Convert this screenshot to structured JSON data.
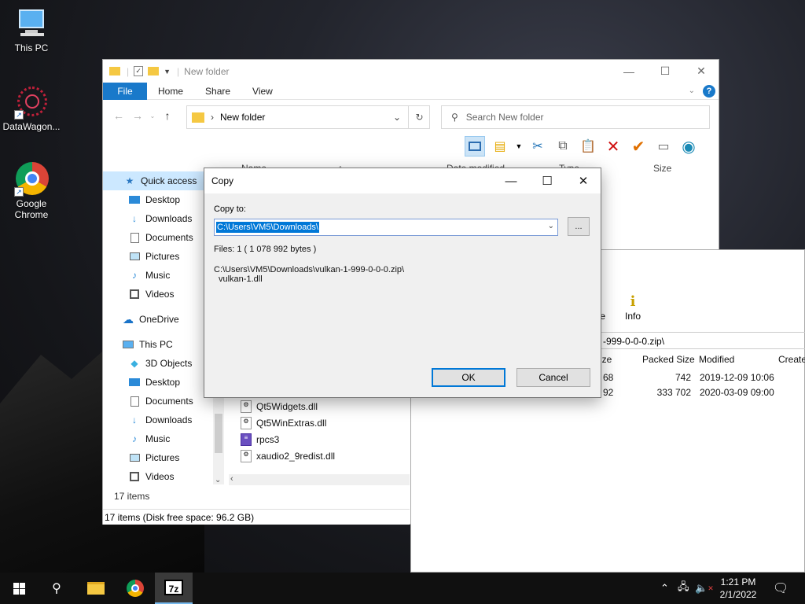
{
  "desktop": {
    "icons": [
      {
        "label": "This PC"
      },
      {
        "label": "DataWagon..."
      },
      {
        "label": "Google Chrome"
      }
    ]
  },
  "explorer": {
    "title": "New folder",
    "tabs": {
      "file": "File",
      "home": "Home",
      "share": "Share",
      "view": "View"
    },
    "address": "New folder",
    "search_placeholder": "Search New folder",
    "columns": {
      "name": "Name",
      "date": "Date modified",
      "type": "Type",
      "size": "Size"
    },
    "nav": {
      "quick_access": "Quick access",
      "qa_desktop": "Desktop",
      "qa_downloads": "Downloads",
      "qa_documents": "Documents",
      "qa_pictures": "Pictures",
      "qa_music": "Music",
      "qa_videos": "Videos",
      "onedrive": "OneDrive",
      "this_pc": "This PC",
      "pc_3d": "3D Objects",
      "pc_desktop": "Desktop",
      "pc_documents": "Documents",
      "pc_downloads": "Downloads",
      "pc_music": "Music",
      "pc_pictures": "Pictures",
      "pc_videos": "Videos"
    },
    "files": [
      "Qt5Widgets.dll",
      "Qt5WinExtras.dll",
      "rpcs3",
      "xaudio2_9redist.dll"
    ],
    "status_count": "17 items",
    "status_bar": "17 items (Disk free space: 96.2 GB)"
  },
  "sevenzip": {
    "tool_partial": "te",
    "tool_info": "Info",
    "path": "-999-0-0-0.zip\\",
    "columns": {
      "size": "ize",
      "packed": "Packed Size",
      "modified": "Modified",
      "created": "Create"
    },
    "rows": [
      {
        "size": "68",
        "packed": "742",
        "modified": "2019-12-09 10:06"
      },
      {
        "size": "92",
        "packed": "333 702",
        "modified": "2020-03-09 09:00"
      }
    ]
  },
  "dialog": {
    "title": "Copy",
    "copy_to_label": "Copy to:",
    "copy_to_value": "C:\\Users\\VM5\\Downloads\\",
    "browse_label": "...",
    "files_info": "Files: 1    ( 1 078 992 bytes )",
    "source_path": "C:\\Users\\VM5\\Downloads\\vulkan-1-999-0-0-0.zip\\",
    "source_file": "vulkan-1.dll",
    "ok": "OK",
    "cancel": "Cancel"
  },
  "taskbar": {
    "time": "1:21 PM",
    "date": "2/1/2022",
    "sevenzip_label": "7z"
  }
}
